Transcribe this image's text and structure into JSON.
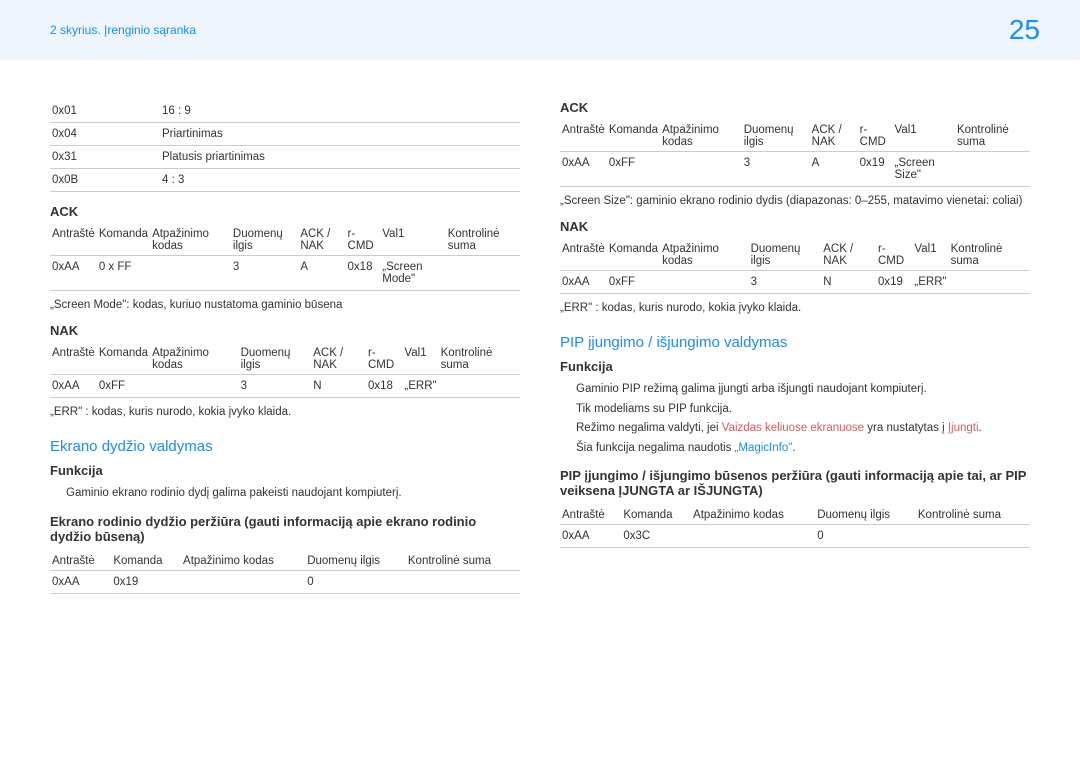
{
  "header": {
    "breadcrumb": "2 skyrius. Įrenginio sąranka",
    "page_number": "25"
  },
  "left": {
    "codes_table": [
      {
        "code": "0x01",
        "desc": "16 : 9"
      },
      {
        "code": "0x04",
        "desc": "Priartinimas"
      },
      {
        "code": "0x31",
        "desc": "Platusis priartinimas"
      },
      {
        "code": "0x0B",
        "desc": "4 : 3"
      }
    ],
    "ack_title": "ACK",
    "ack_headers": [
      "Antraštė",
      "Komanda",
      "Atpažinimo kodas",
      "Duomenų ilgis",
      "ACK / NAK",
      "r-CMD",
      "Val1",
      "Kontrolinė suma"
    ],
    "ack_row": [
      "0xAA",
      "0 x FF",
      "",
      "3",
      "A",
      "0x18",
      "„Screen Mode\"",
      ""
    ],
    "ack_note": "„Screen Mode\": kodas, kuriuo nustatoma gaminio būsena",
    "nak_title": "NAK",
    "nak_headers": [
      "Antraštė",
      "Komanda",
      "Atpažinimo kodas",
      "Duomenų ilgis",
      "ACK / NAK",
      "r-CMD",
      "Val1",
      "Kontrolinė suma"
    ],
    "nak_row": [
      "0xAA",
      "0xFF",
      "",
      "3",
      "N",
      "0x18",
      "„ERR\"",
      ""
    ],
    "nak_note": "„ERR\" : kodas, kuris nurodo, kokia įvyko klaida.",
    "size_control_title": "Ekrano dydžio valdymas",
    "funkcija_title": "Funkcija",
    "funkcija_text": "Gaminio ekrano rodinio dydį galima pakeisti naudojant kompiuterį.",
    "size_view_title": "Ekrano rodinio dydžio peržiūra (gauti informaciją apie ekrano rodinio dydžio būseną)",
    "size_headers": [
      "Antraštė",
      "Komanda",
      "Atpažinimo kodas",
      "Duomenų ilgis",
      "Kontrolinė suma"
    ],
    "size_row": [
      "0xAA",
      "0x19",
      "",
      "0",
      ""
    ]
  },
  "right": {
    "ack_title": "ACK",
    "ack_headers": [
      "Antraštė",
      "Komanda",
      "Atpažinimo kodas",
      "Duomenų ilgis",
      "ACK / NAK",
      "r-CMD",
      "Val1",
      "Kontrolinė suma"
    ],
    "ack_row": [
      "0xAA",
      "0xFF",
      "",
      "3",
      "A",
      "0x19",
      "„Screen Size\"",
      ""
    ],
    "ack_note": "„Screen Size\": gaminio ekrano rodinio dydis (diapazonas: 0–255, matavimo vienetai: coliai)",
    "nak_title": "NAK",
    "nak_headers": [
      "Antraštė",
      "Komanda",
      "Atpažinimo kodas",
      "Duomenų ilgis",
      "ACK / NAK",
      "r-CMD",
      "Val1",
      "Kontrolinė suma"
    ],
    "nak_row": [
      "0xAA",
      "0xFF",
      "",
      "3",
      "N",
      "0x19",
      "„ERR\"",
      ""
    ],
    "nak_note": "„ERR\" : kodas, kuris nurodo, kokia įvyko klaida.",
    "pip_title": "PIP įjungimo / išjungimo valdymas",
    "funkcija_title": "Funkcija",
    "funkcija_lines": {
      "l1": "Gaminio PIP režimą galima įjungti arba išjungti naudojant kompiuterį.",
      "l2": "Tik modeliams su PIP funkcija.",
      "l3a": "Režimo negalima valdyti, jei ",
      "l3b": "Vaizdas keliuose ekranuose",
      "l3c": " yra nustatytas į ",
      "l3d": "Įjungti",
      "l3e": ".",
      "l4a": "Šia funkcija negalima naudotis ",
      "l4b": "„MagicInfo\"",
      "l4c": "."
    },
    "pip_status_title": "PIP įjungimo / išjungimo būsenos peržiūra (gauti informaciją apie tai, ar PIP veiksena ĮJUNGTA ar IŠJUNGTA)",
    "pip_headers": [
      "Antraštė",
      "Komanda",
      "Atpažinimo kodas",
      "Duomenų ilgis",
      "Kontrolinė suma"
    ],
    "pip_row": [
      "0xAA",
      "0x3C",
      "",
      "0",
      ""
    ]
  }
}
